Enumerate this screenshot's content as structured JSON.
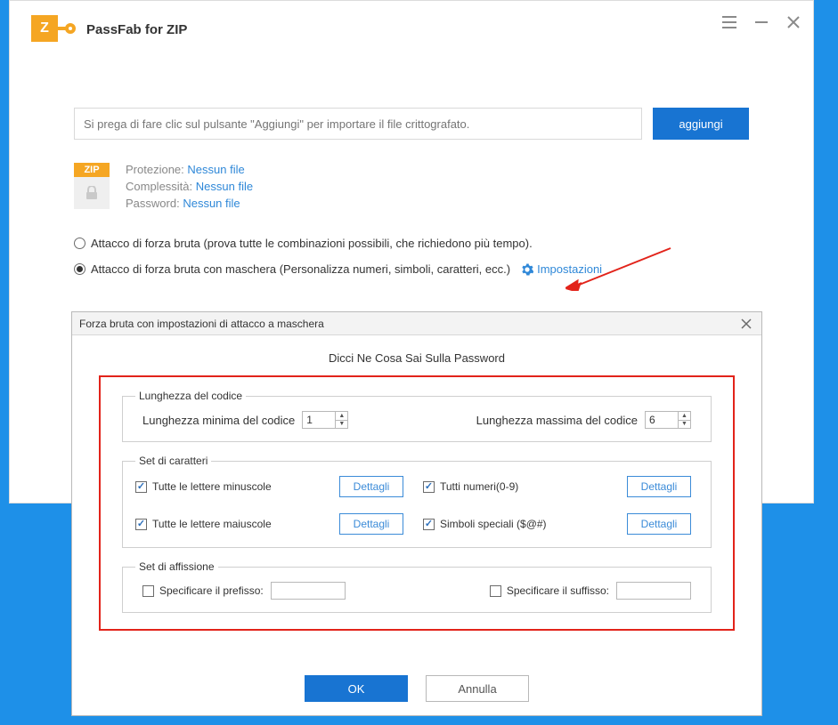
{
  "app": {
    "title": "PassFab for ZIP",
    "logo_letter": "Z"
  },
  "import": {
    "placeholder": "Si prega di fare clic sul pulsante \"Aggiungi\" per importare il file crittografato.",
    "add_btn": "aggiungi"
  },
  "fileinfo": {
    "zip_label": "ZIP",
    "protection_label": "Protezione:",
    "protection_value": "Nessun file",
    "complexity_label": "Complessità:",
    "complexity_value": "Nessun file",
    "password_label": "Password:",
    "password_value": "Nessun file"
  },
  "attacks": {
    "brute_label": "Attacco di forza bruta (prova tutte le combinazioni possibili, che richiedono più tempo).",
    "mask_label": "Attacco di forza bruta con maschera (Personalizza numeri, simboli, caratteri, ecc.)",
    "settings_link": "Impostazioni"
  },
  "modal": {
    "title": "Forza bruta con impostazioni di attacco a maschera",
    "subtitle": "Dicci Ne Cosa Sai Sulla Password",
    "length": {
      "legend": "Lunghezza del codice",
      "min_label": "Lunghezza minima del codice",
      "min_value": "1",
      "max_label": "Lunghezza massima del codice",
      "max_value": "6"
    },
    "charset": {
      "legend": "Set di caratteri",
      "lower": "Tutte le lettere minuscole",
      "upper": "Tutte le lettere maiuscole",
      "numbers": "Tutti numeri(0-9)",
      "symbols": "Simboli speciali ($@#)",
      "details_btn": "Dettagli"
    },
    "affix": {
      "legend": "Set di affissione",
      "prefix": "Specificare il prefisso:",
      "suffix": "Specificare il suffisso:"
    },
    "ok_btn": "OK",
    "cancel_btn": "Annulla"
  }
}
